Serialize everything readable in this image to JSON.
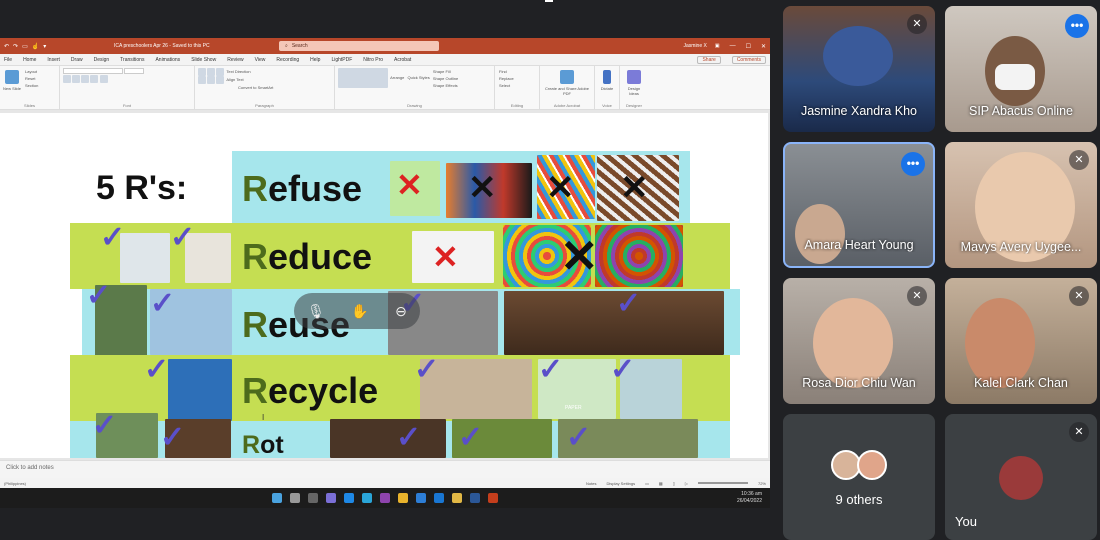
{
  "ppt": {
    "title": "ICA preschoolers Apr 26 - Saved to this PC",
    "search_placeholder": "Search",
    "user": "Jasmine X",
    "menu_tabs": [
      "File",
      "Home",
      "Insert",
      "Draw",
      "Design",
      "Transitions",
      "Animations",
      "Slide Show",
      "Review",
      "View",
      "Recording",
      "Help",
      "LightPDF",
      "Nitro Pro",
      "Acrobat"
    ],
    "share_label": "Share",
    "comments_label": "Comments",
    "ribbon_groups": [
      "Slides",
      "Font",
      "Paragraph",
      "Drawing",
      "Editing",
      "Adobe Acrobat",
      "Voice",
      "Designer"
    ],
    "ribbon_items": {
      "new_slide": "New Slide",
      "layout": "Layout",
      "reset": "Reset",
      "section": "Section",
      "text_direction": "Text Direction",
      "align_text": "Align Text",
      "convert_smartart": "Convert to SmartArt",
      "arrange": "Arrange",
      "quick_styles": "Quick Styles",
      "shape_fill": "Shape Fill",
      "shape_outline": "Shape Outline",
      "shape_effects": "Shape Effects",
      "find": "Find",
      "replace": "Replace",
      "select": "Select",
      "create_share_pdf": "Create and Share Adobe PDF",
      "dictate": "Dictate",
      "design_ideas": "Design Ideas"
    },
    "notes_placeholder": "Click to add notes",
    "status_left": "(Philippines)",
    "status_notes": "Notes",
    "status_display": "Display Settings",
    "zoom": "72%",
    "time": "10:36 am",
    "date": "26/04/2022"
  },
  "slide": {
    "title": "5 R's:",
    "words": [
      {
        "first": "R",
        "rest": "efuse"
      },
      {
        "first": "R",
        "rest": "educe"
      },
      {
        "first": "R",
        "rest": "euse"
      },
      {
        "first": "R",
        "rest": "ecycle"
      },
      {
        "first": "R",
        "rest": "ot"
      }
    ],
    "recycle_bin_text": "PAPER",
    "colors": {
      "cyan": "#a6e6ec",
      "lime": "#c5de52",
      "word_green": "#4d6b1c",
      "check_purple": "#5a4fc9"
    }
  },
  "participants": [
    {
      "name": "Jasmine Xandra Kho",
      "muted": true
    },
    {
      "name": "SIP Abacus Online",
      "muted": false,
      "speaking": true
    },
    {
      "name": "Amara Heart Young",
      "muted": false,
      "menu": true
    },
    {
      "name": "Mavys Avery Uygee...",
      "muted": true
    },
    {
      "name": "Rosa Dior Chiu Wan",
      "muted": true
    },
    {
      "name": "Kalel Clark Chan",
      "muted": true
    }
  ],
  "others": {
    "label": "9 others"
  },
  "you": {
    "label": "You",
    "muted": true
  }
}
